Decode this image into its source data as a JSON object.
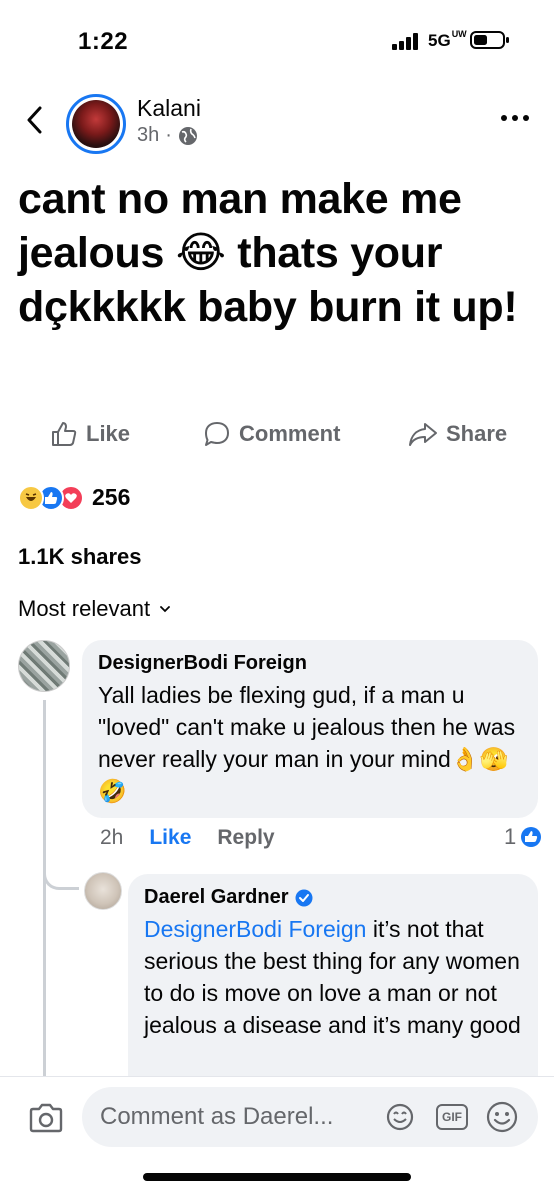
{
  "status_bar": {
    "time": "1:22",
    "network": "5G",
    "network_badge": "UW"
  },
  "post": {
    "author": "Kalani",
    "time": "3h",
    "separator": "·",
    "text": "cant no man make me jealous 😂 thats your dçkkkkk baby burn it up!",
    "actions": {
      "like": "Like",
      "comment": "Comment",
      "share": "Share"
    },
    "reaction_count": "256",
    "shares": "1.1K shares",
    "sort_label": "Most relevant"
  },
  "comments": [
    {
      "author": "DesignerBodi Foreign",
      "text": "Yall ladies be flexing gud, if a man u \"loved\" can't make u jealous then he was never really your man in your mind👌🫣🤣",
      "time": "2h",
      "like_label": "Like",
      "reply_label": "Reply",
      "reaction_count": "1"
    },
    {
      "author": "Daerel Gardner",
      "verified": true,
      "mention": "DesignerBodi Foreign",
      "text": " it’s not that serious the best thing for any women to do is move on love a man or not jealous a disease and it’s many good"
    }
  ],
  "composer": {
    "placeholder": "Comment as Daerel...",
    "gif_label": "GIF"
  },
  "icons": {
    "back": "chevron-left-icon",
    "more": "more-horizontal-icon",
    "globe": "globe-icon",
    "like": "thumbs-up-icon",
    "comment": "comment-bubble-icon",
    "share": "share-arrow-icon",
    "camera": "camera-icon",
    "sticker": "sticker-icon",
    "emoji": "emoji-icon",
    "verified": "verified-badge-icon"
  },
  "colors": {
    "accent": "#1877f2",
    "secondary_text": "#65676b",
    "bubble": "#f0f2f5"
  }
}
